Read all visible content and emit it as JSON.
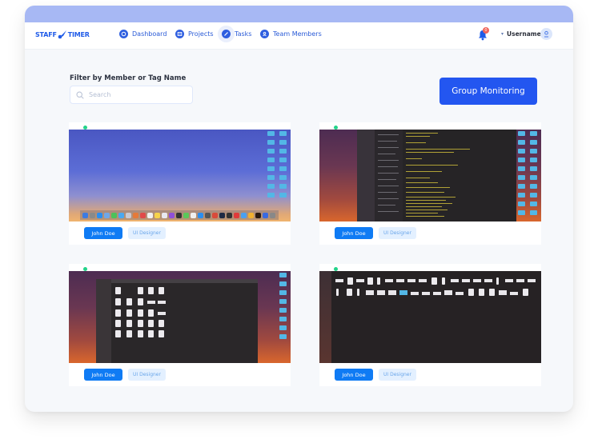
{
  "brand": {
    "logo_left": "STAFF",
    "logo_right": "TIMER"
  },
  "nav": {
    "items": [
      {
        "label": "Dashboard",
        "icon": "dashboard-icon"
      },
      {
        "label": "Projects",
        "icon": "projects-icon"
      },
      {
        "label": "Tasks",
        "icon": "tasks-icon",
        "active": true
      },
      {
        "label": "Team Members",
        "icon": "team-members-icon"
      }
    ]
  },
  "header": {
    "notification_count": "0",
    "username": "Username"
  },
  "filter": {
    "label": "Filter by Member or Tag Name",
    "search_placeholder": "Search",
    "search_value": ""
  },
  "actions": {
    "group_monitoring_label": "Group Monitoring"
  },
  "cards": [
    {
      "member": "John Doe",
      "tag": "UI Designer",
      "status": "online",
      "screen": "desktop-blue-dock"
    },
    {
      "member": "John Doe",
      "tag": "UI Designer",
      "status": "online",
      "screen": "code-editor"
    },
    {
      "member": "John Doe",
      "tag": "UI Designer",
      "status": "online",
      "screen": "finder-files"
    },
    {
      "member": "John Doe",
      "tag": "UI Designer",
      "status": "online",
      "screen": "finder-icons"
    }
  ],
  "colors": {
    "accent": "#2356f0",
    "topbar": "#a7b8f4",
    "member_button": "#0f7bf4",
    "tag_button_bg": "#e3f0ff",
    "status_online": "#22d38a",
    "badge": "#f0645a"
  }
}
